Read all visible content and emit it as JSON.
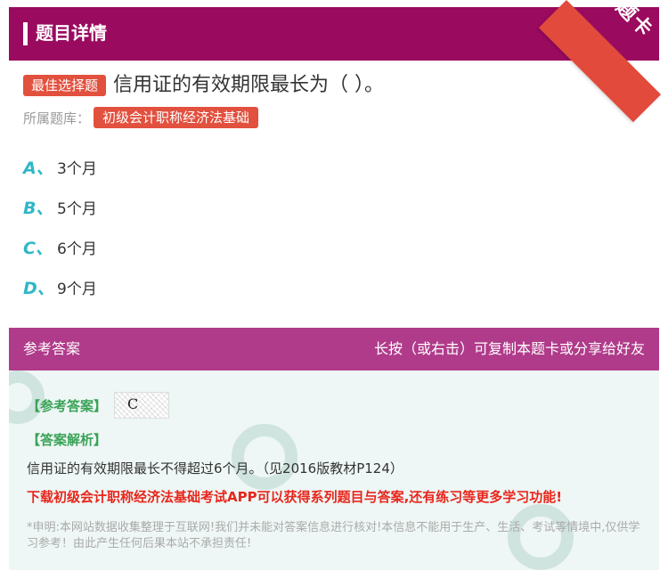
{
  "header": {
    "title": "题目详情",
    "ribbon": "题卡"
  },
  "question": {
    "type_badge": "最佳选择题",
    "text": "信用证的有效期限最长为（ ）。",
    "bank_label": "所属题库：",
    "bank_name": "初级会计职称经济法基础"
  },
  "options": [
    {
      "letter": "A、",
      "text": "3个月"
    },
    {
      "letter": "B、",
      "text": "5个月"
    },
    {
      "letter": "C、",
      "text": "6个月"
    },
    {
      "letter": "D、",
      "text": "9个月"
    }
  ],
  "answer_section": {
    "title": "参考答案",
    "hint": "长按（或右击）可复制本题卡或分享给好友",
    "ref_label": "【参考答案】",
    "ref_answer": "C",
    "analysis_label": "【答案解析】",
    "analysis": "信用证的有效期限最长不得超过6个月。（见2016版教材P124）",
    "promo": "下载初级会计职称经济法基础考试APP可以获得系列题目与答案,还有练习等更多学习功能!",
    "disclaimer": "*申明:本网站数据收集整理于互联网!我们并未能对答案信息进行核对!本信息不能用于生产、生活、考试等情境中,仅供学习参考！由此产生任何后果本站不承担责任!"
  },
  "colors": {
    "header": "#9a0a5f",
    "accent_red": "#e2503e",
    "option_letter": "#2fb7c7",
    "answer_head": "#b03b8a",
    "green_label": "#3aa357",
    "promo": "#e8261c"
  }
}
